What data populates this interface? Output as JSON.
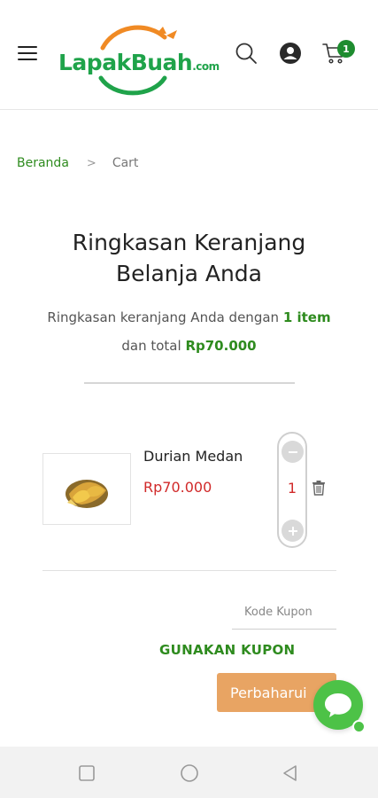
{
  "header": {
    "logo": {
      "text": "LapakBuah",
      "suffix": ".com"
    },
    "cart_count": "1",
    "icons": [
      "hamburger-icon",
      "search-icon",
      "user-icon",
      "cart-icon"
    ]
  },
  "breadcrumb": {
    "home": "Beranda",
    "separator": ">",
    "current": "Cart"
  },
  "page": {
    "title_line1": "Ringkasan Keranjang",
    "title_line2": "Belanja Anda",
    "summary_prefix": "Ringkasan keranjang Anda dengan",
    "summary_items": "1 item",
    "summary_middle": "dan total",
    "summary_total": "Rp70.000"
  },
  "cart": {
    "items": [
      {
        "name": "Durian Medan",
        "price": "Rp70.000",
        "quantity": "1"
      }
    ]
  },
  "coupon": {
    "placeholder": "Kode Kupon",
    "apply_label": "GUNAKAN KUPON",
    "update_label": "Perbaharui"
  },
  "colors": {
    "brand_green": "#2e8b1e",
    "price_red": "#d12a2a",
    "update_button": "#e8a463",
    "chat_green": "#4dc247"
  }
}
